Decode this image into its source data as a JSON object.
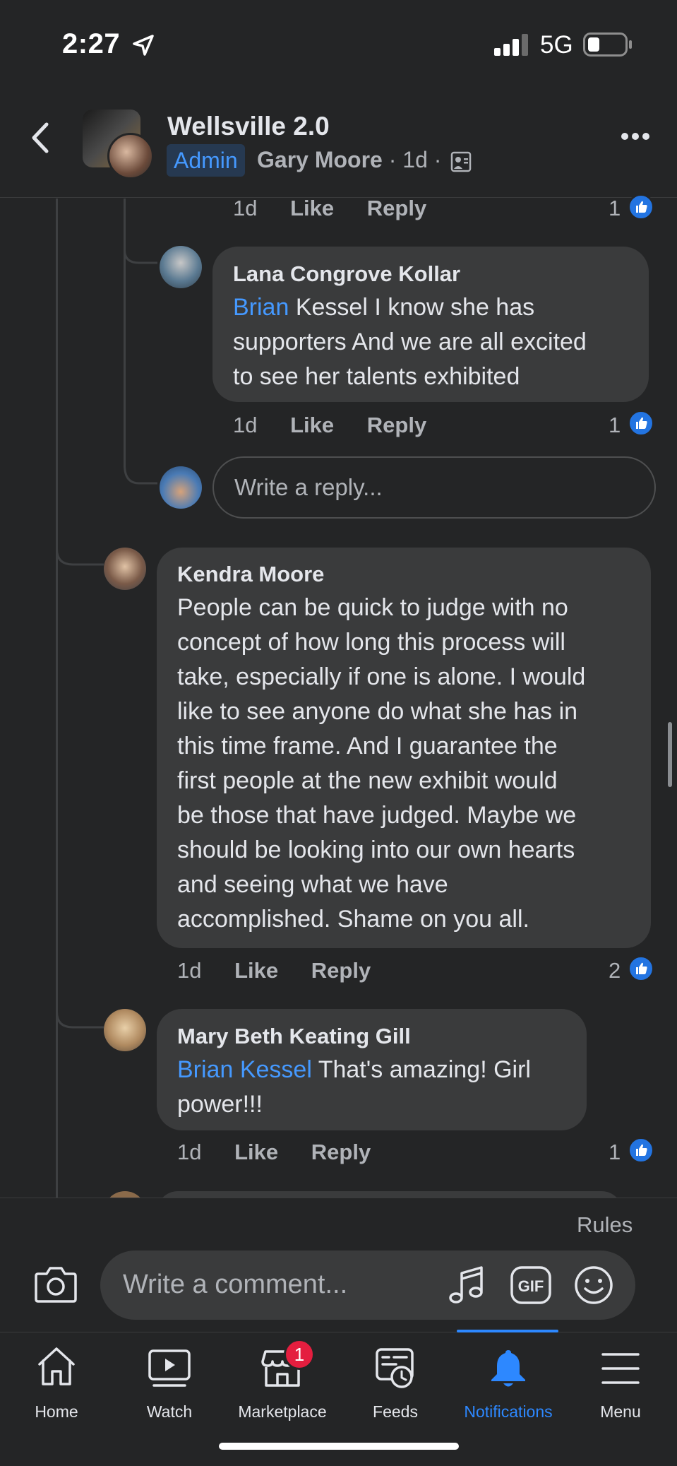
{
  "status": {
    "time": "2:27",
    "network": "5G"
  },
  "header": {
    "group_name": "Wellsville 2.0",
    "role_badge": "Admin",
    "author": "Gary Moore",
    "time_sep": " · 1d · "
  },
  "prev_comment_meta": {
    "time": "1d",
    "like": "Like",
    "reply": "Reply",
    "reactions": "1"
  },
  "comments": [
    {
      "name": "Lana Congrove Kollar",
      "tag": "Brian",
      "lines": [
        "Kessel I know she has",
        "supporters And we are all excited",
        "to see her talents exhibited"
      ],
      "time": "1d",
      "like": "Like",
      "reply": "Reply",
      "reactions": "1"
    },
    {
      "name": "Kendra Moore",
      "lines": [
        "People can be quick to judge with no",
        "concept of how long this process will",
        "take, especially if one is alone. I would",
        "like to see anyone do what she has in",
        "this time frame. And I guarantee the",
        "first people at the new exhibit would",
        "be those that have judged. Maybe we",
        "should be looking into our own hearts",
        "and seeing what we have",
        "accomplished. Shame on you all."
      ],
      "time": "1d",
      "like": "Like",
      "reply": "Reply",
      "reactions": "2"
    },
    {
      "name": "Mary Beth Keating Gill",
      "tag": "Brian Kessel",
      "lines": [
        "That's amazing! Girl",
        "power!!!"
      ],
      "time": "1d",
      "like": "Like",
      "reply": "Reply",
      "reactions": "1"
    }
  ],
  "reply_input": {
    "placeholder": "Write a reply..."
  },
  "composer": {
    "rules": "Rules",
    "placeholder": "Write a comment..."
  },
  "tabs": [
    {
      "label": "Home",
      "icon": "home-icon"
    },
    {
      "label": "Watch",
      "icon": "watch-icon"
    },
    {
      "label": "Marketplace",
      "icon": "marketplace-icon",
      "badge": "1"
    },
    {
      "label": "Feeds",
      "icon": "feeds-icon"
    },
    {
      "label": "Notifications",
      "icon": "bell-icon",
      "active": true
    },
    {
      "label": "Menu",
      "icon": "menu-icon"
    }
  ],
  "colors": {
    "background": "#242526",
    "bubble": "#3a3b3c",
    "link": "#4599ff",
    "active_tab": "#2d88ff",
    "badge": "#e41e3f"
  }
}
